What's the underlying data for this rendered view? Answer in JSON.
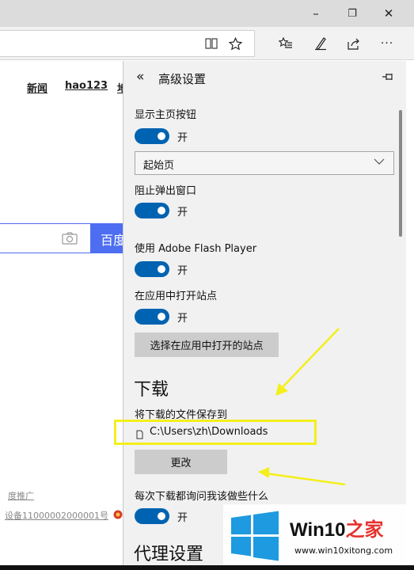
{
  "window": {
    "minimize_glyph": "–",
    "restore_glyph": "❐",
    "close_glyph": "✕"
  },
  "toolbar": {
    "icons": [
      "reading-view-icon",
      "favorite-star-icon",
      "favorites-hub-icon",
      "web-note-icon",
      "share-icon",
      "more-icon"
    ],
    "more_glyph": "···"
  },
  "page": {
    "links": [
      "新闻",
      "hao123",
      "地"
    ],
    "search_button": "百度",
    "footer_line1": "度推广",
    "footer_line2": "设备11000002000001号"
  },
  "settings": {
    "back_glyph": "«",
    "title": "高级设置",
    "pin_glyph": "⊣",
    "home_button_label": "显示主页按钮",
    "home_toggle": "开",
    "home_select_value": "起始页",
    "popup_label": "阻止弹出窗口",
    "popup_toggle": "开",
    "flash_label": "使用 Adobe Flash Player",
    "flash_toggle": "开",
    "apps_label": "在应用中打开站点",
    "apps_toggle": "开",
    "apps_button": "选择在应用中打开的站点",
    "download_heading": "下载",
    "save_to_label": "将下载的文件保存到",
    "download_path": "C:\\Users\\zh\\Downloads",
    "change_button": "更改",
    "ask_label": "每次下载都询问我该做些什么",
    "ask_toggle": "开",
    "proxy_heading": "代理设置"
  },
  "watermark": {
    "brand": "Win10",
    "brand_suffix": "之家",
    "url": "www.win10xitong.com"
  },
  "colors": {
    "accent": "#0063b1",
    "highlight": "#f4ef1a",
    "search_blue": "#4e6ef2"
  }
}
